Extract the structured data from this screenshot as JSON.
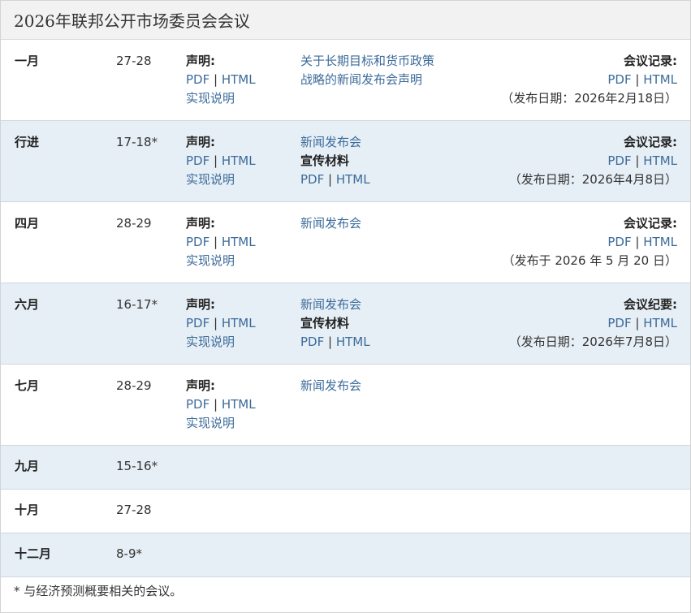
{
  "title": "2026年联邦公开市场委员会会议",
  "labels": {
    "statement": "声明:",
    "minutes": "会议记录:",
    "minutes_alt": "会议纪要:",
    "pdf": "PDF",
    "html": "HTML",
    "sep": "|",
    "implementation_note": "实现说明",
    "press_conference": "新闻发布会",
    "promo_materials": "宣传材料"
  },
  "meetings": [
    {
      "month": "一月",
      "dates": "27-28",
      "minor_line1": "关于长期目标和货币政策",
      "minor_line2": "战略的新闻发布会声明",
      "released": "（发布日期：2026年2月18日）"
    },
    {
      "month": "行进",
      "dates": "17-18*",
      "released": "（发布日期：2026年4月8日）"
    },
    {
      "month": "四月",
      "dates": "28-29",
      "released": "（发布于 2026 年 5 月 20 日）"
    },
    {
      "month": "六月",
      "dates": "16-17*",
      "released": "（发布日期：2026年7月8日）"
    },
    {
      "month": "七月",
      "dates": "28-29"
    },
    {
      "month": "九月",
      "dates": "15-16*"
    },
    {
      "month": "十月",
      "dates": "27-28"
    },
    {
      "month": "十二月",
      "dates": "8-9*"
    }
  ],
  "footnote": "* 与经济预测概要相关的会议。",
  "colors": {
    "link": "#3c6b9a",
    "shaded_row": "#e6eff6",
    "header_bg": "#f2f2f2"
  }
}
